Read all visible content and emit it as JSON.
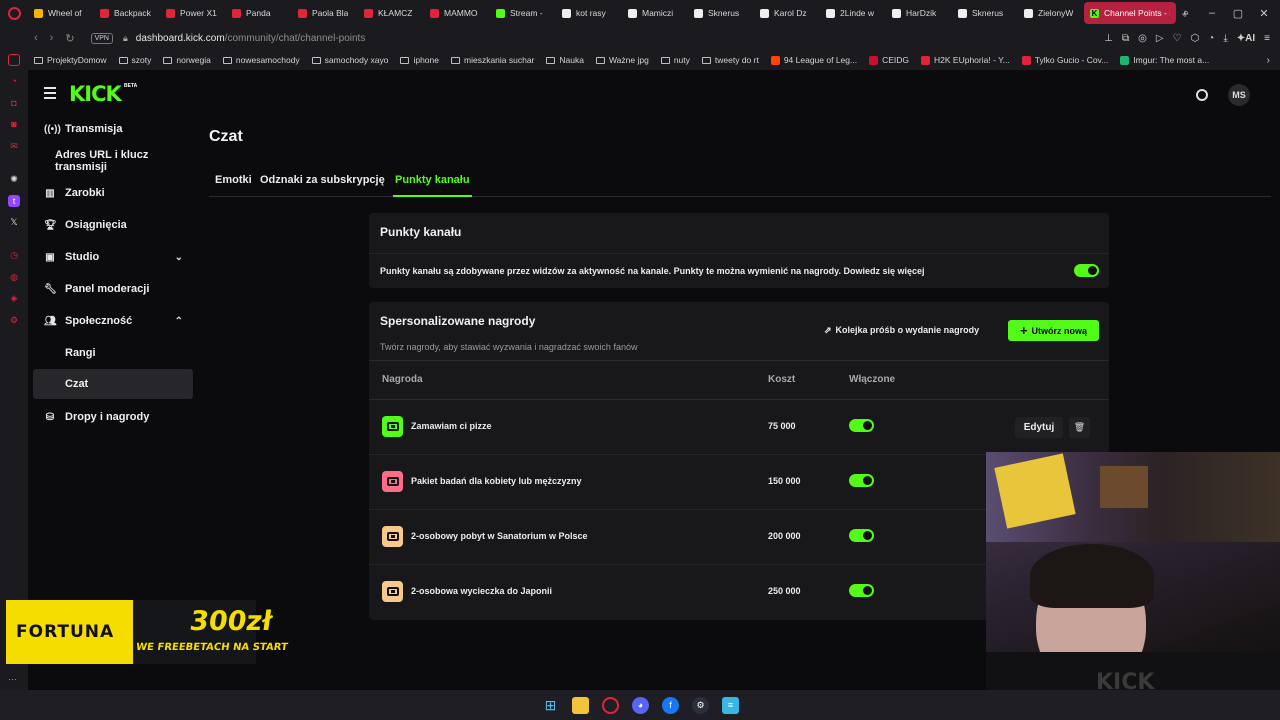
{
  "browser": {
    "tabs": [
      {
        "label": "Wheel of",
        "color": "#f7b500"
      },
      {
        "label": "Backpack",
        "color": "#e0253b"
      },
      {
        "label": "Power X1",
        "color": "#e0253b"
      },
      {
        "label": "Panda",
        "color": "#e0253b"
      },
      {
        "label": "Paola Bla",
        "color": "#e0253b"
      },
      {
        "label": "KŁAMCZ",
        "color": "#e0253b"
      },
      {
        "label": "MAMMO",
        "color": "#e0253b"
      },
      {
        "label": "Stream -",
        "color": "#53fc18"
      },
      {
        "label": "kot rasy",
        "color": "#eeeeee"
      },
      {
        "label": "Mamiczi",
        "color": "#eeeeee"
      },
      {
        "label": "Sknerus",
        "color": "#eeeeee"
      },
      {
        "label": "Karol Dz",
        "color": "#eeeeee"
      },
      {
        "label": "2Linde w",
        "color": "#eeeeee"
      },
      {
        "label": "HarDzik",
        "color": "#eeeeee"
      },
      {
        "label": "Sknerus",
        "color": "#eeeeee"
      },
      {
        "label": "ZielonyW",
        "color": "#eeeeee"
      }
    ],
    "active_tab": "Channel Points - K",
    "vpn_label": "VPN",
    "url_host": "dashboard.kick.com",
    "url_path": "/community/chat/channel-points",
    "ai_label": "AI",
    "bookmarks": [
      {
        "label": "ProjektyDomow",
        "type": "folder"
      },
      {
        "label": "szoty",
        "type": "folder"
      },
      {
        "label": "norwegia",
        "type": "folder"
      },
      {
        "label": "nowesamochody",
        "type": "folder"
      },
      {
        "label": "samochody xayo",
        "type": "folder"
      },
      {
        "label": "iphone",
        "type": "folder"
      },
      {
        "label": "mieszkania suchar",
        "type": "folder"
      },
      {
        "label": "Nauka",
        "type": "folder"
      },
      {
        "label": "Ważne jpg",
        "type": "folder"
      },
      {
        "label": "nuty",
        "type": "folder"
      },
      {
        "label": "tweety do rt",
        "type": "folder"
      },
      {
        "label": "94 League of Leg...",
        "type": "site",
        "color": "#ff4500"
      },
      {
        "label": "CEIDG",
        "type": "site",
        "color": "#c8102e"
      },
      {
        "label": "H2K EUphoria! - Y...",
        "type": "site",
        "color": "#e0253b"
      },
      {
        "label": "Tylko Gucio - Cov...",
        "type": "site",
        "color": "#e0253b"
      },
      {
        "label": "Imgur: The most a...",
        "type": "site",
        "color": "#1bb76e"
      }
    ]
  },
  "header": {
    "logo": "KICK",
    "beta": "BETA",
    "avatar_initials": "MS"
  },
  "sidebar": {
    "items": [
      {
        "label": "Transmisja",
        "icon": "broadcast-icon"
      },
      {
        "label": "Adres URL i klucz transmisji",
        "icon": ""
      },
      {
        "label": "Zarobki",
        "icon": "chart-icon"
      },
      {
        "label": "Osiągnięcia",
        "icon": "trophy-icon"
      },
      {
        "label": "Studio",
        "icon": "studio-icon"
      },
      {
        "label": "Panel moderacji",
        "icon": "wrench-icon"
      },
      {
        "label": "Społeczność",
        "icon": "people-icon"
      },
      {
        "label": "Rangi",
        "icon": ""
      },
      {
        "label": "Czat",
        "icon": ""
      },
      {
        "label": "Dropy i nagrody",
        "icon": "drops-icon"
      }
    ]
  },
  "main": {
    "title": "Czat",
    "tabs": [
      {
        "label": "Emotki"
      },
      {
        "label": "Odznaki za subskrypcję"
      },
      {
        "label": "Punkty kanału"
      }
    ],
    "points_card": {
      "title": "Punkty kanału",
      "description": "Punkty kanału są zdobywane przez widzów za aktywność na kanale. Punkty te można wymienić na nagrody. Dowiedz się więcej",
      "enabled": true
    },
    "rewards_card": {
      "title": "Spersonalizowane nagrody",
      "subtitle": "Twórz nagrody, aby stawiać wyzwania i nagradzać swoich fanów",
      "queue_button": "Kolejka próśb o wydanie nagrody",
      "create_button": "Utwórz nową",
      "columns": [
        "Nagroda",
        "Koszt",
        "Włączone"
      ],
      "rows": [
        {
          "name": "Zamawiam ci pizze",
          "cost": "75 000",
          "enabled": true,
          "color": "#53fc18",
          "edit": "Edytuj"
        },
        {
          "name": "Pakiet badań dla kobiety lub mężczyzny",
          "cost": "150 000",
          "enabled": true,
          "color": "#ff6b8a"
        },
        {
          "name": "2-osobowy pobyt w Sanatorium w Polsce",
          "cost": "200 000",
          "enabled": true,
          "color": "#f7c98a"
        },
        {
          "name": "2-osobowa wycieczka do Japonii",
          "cost": "250 000",
          "enabled": true,
          "color": "#f7c98a"
        }
      ]
    }
  },
  "overlay": {
    "brand": "FORTUNA",
    "amount": "300zł",
    "promo": "WE FREEBETACH NA START",
    "webcam_shirt": "KICK"
  }
}
